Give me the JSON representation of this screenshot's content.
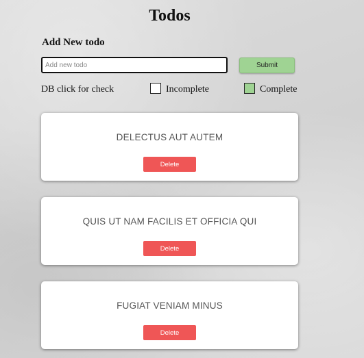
{
  "header": {
    "title": "Todos"
  },
  "form": {
    "label": "Add New todo",
    "input_placeholder": "Add new todo",
    "input_value": "",
    "submit_label": "Submit"
  },
  "legend": {
    "hint": "DB click for check",
    "incomplete_label": "Incomplete",
    "complete_label": "Complete",
    "incomplete_color": "#ffffff",
    "complete_color": "#9fd393"
  },
  "todos": [
    {
      "title": "DELECTUS AUT AUTEM",
      "delete_label": "Delete",
      "completed": false
    },
    {
      "title": "QUIS UT NAM FACILIS ET OFFICIA QUI",
      "delete_label": "Delete",
      "completed": false
    },
    {
      "title": "FUGIAT VENIAM MINUS",
      "delete_label": "Delete",
      "completed": false
    }
  ],
  "colors": {
    "delete_button": "#ef5656",
    "submit_button": "#9fd393",
    "card_background": "#ffffff"
  }
}
